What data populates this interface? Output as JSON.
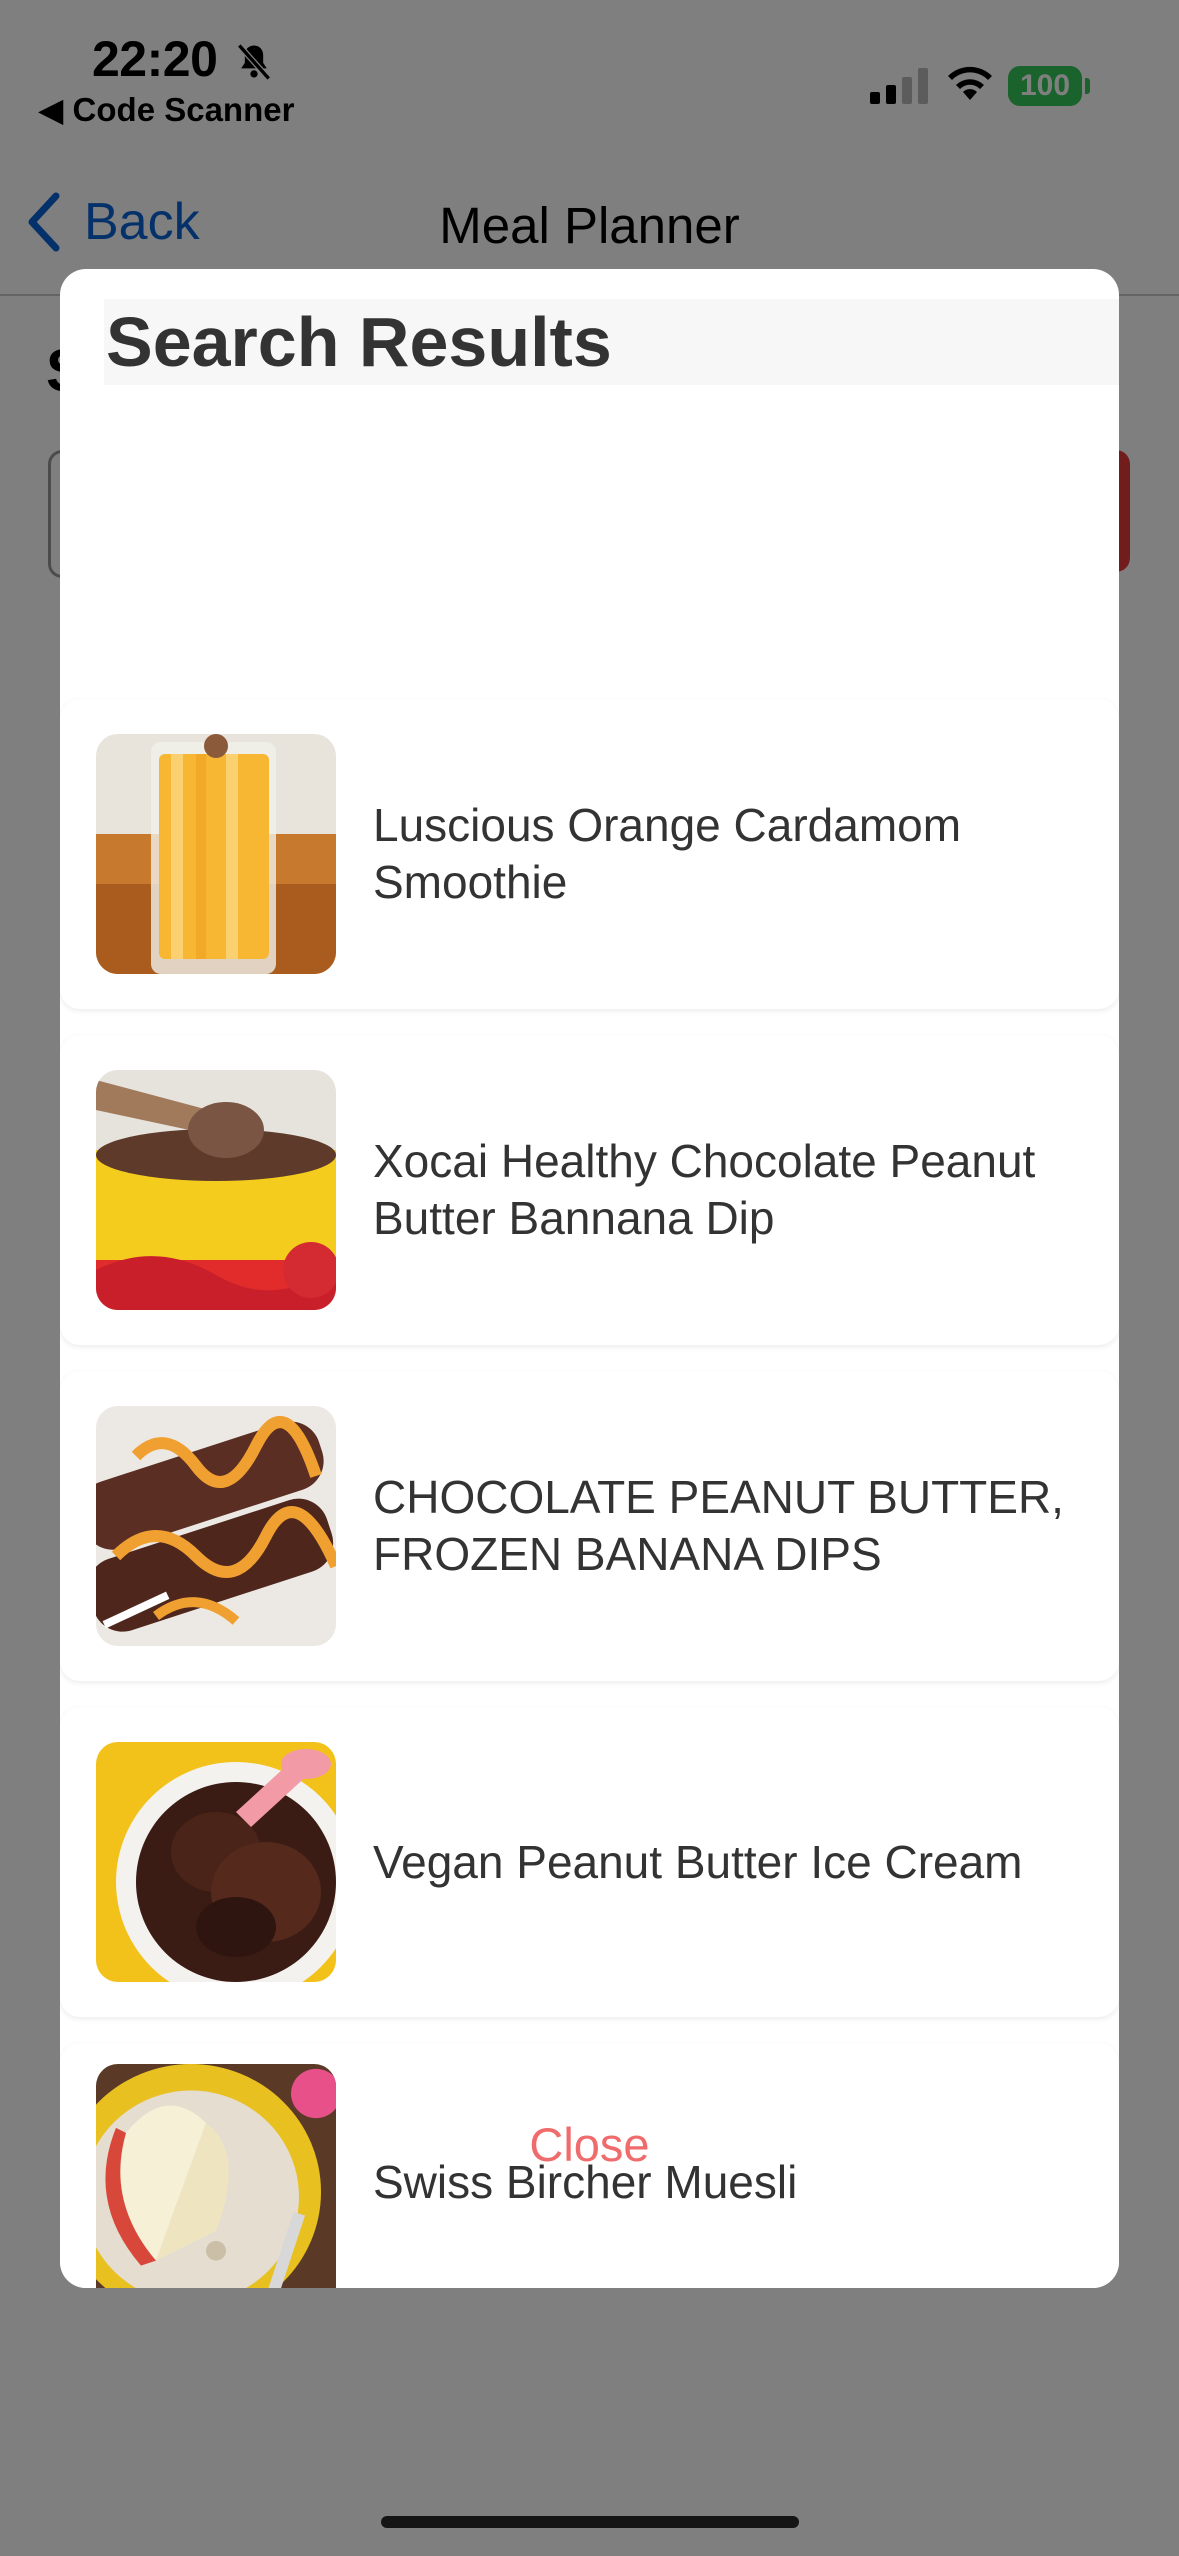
{
  "status_bar": {
    "time": "22:20",
    "back_app": "◀ Code Scanner",
    "battery": "100",
    "battery_color": "#35c759"
  },
  "nav": {
    "back_label": "Back",
    "title": "Meal Planner",
    "accent_color": "#0a62d6"
  },
  "modal": {
    "title": "Search Results",
    "results": [
      {
        "name": "Luscious Orange Cardamom Smoothie",
        "image": "orange-smoothie-photo"
      },
      {
        "name": "Xocai Healthy Chocolate Peanut Butter Bannana Dip",
        "image": "chocolate-dip-photo"
      },
      {
        "name": "CHOCOLATE PEANUT BUTTER, FROZEN BANANA DIPS",
        "image": "frozen-banana-dips-photo"
      },
      {
        "name": "Vegan Peanut Butter Ice Cream",
        "image": "peanut-butter-ice-cream-photo"
      },
      {
        "name": "Swiss Bircher Muesli",
        "image": "bircher-muesli-photo"
      }
    ],
    "close_label": "Close",
    "close_color": "#f06b6b"
  }
}
